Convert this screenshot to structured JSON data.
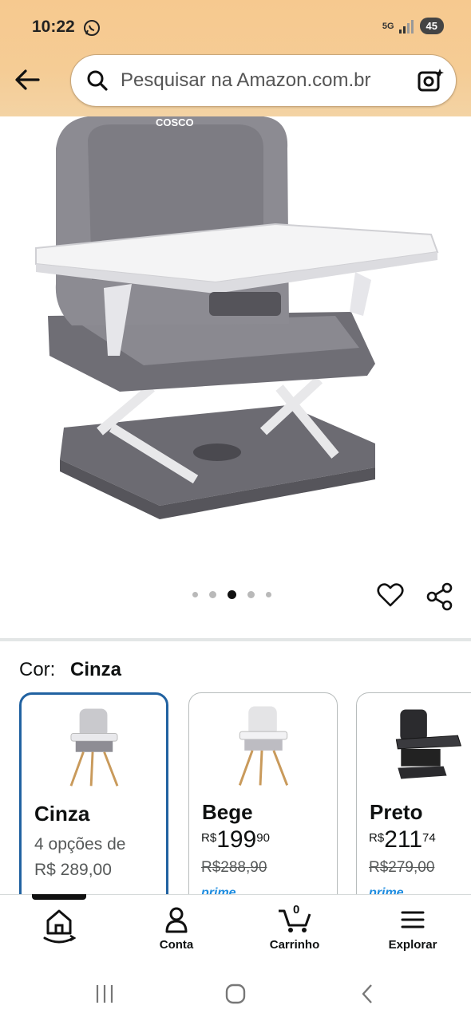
{
  "status_bar": {
    "time": "10:22",
    "network": "5G",
    "battery": "45"
  },
  "search": {
    "placeholder": "Pesquisar na Amazon.com.br"
  },
  "product": {
    "image_brand": "COSCO",
    "pager": {
      "count": 5,
      "active_index": 2
    }
  },
  "color": {
    "label": "Cor:",
    "selected": "Cinza"
  },
  "options": [
    {
      "name": "Cinza",
      "subtitle_line1": "4 opções de",
      "subtitle_line2": "R$ 289,00",
      "selected": true
    },
    {
      "name": "Bege",
      "currency": "R$",
      "price_whole": "199",
      "price_cents": "90",
      "was_price": "R$288,90",
      "badge": "prime"
    },
    {
      "name": "Preto",
      "currency": "R$",
      "price_whole": "211",
      "price_cents": "74",
      "was_price": "R$279,00",
      "badge": "prime"
    }
  ],
  "bottom_nav": {
    "items": [
      {
        "label": "",
        "icon": "home-icon",
        "active": true
      },
      {
        "label": "Conta",
        "icon": "account-icon"
      },
      {
        "label": "Carrinho",
        "icon": "cart-icon",
        "count": "0"
      },
      {
        "label": "Explorar",
        "icon": "menu-icon"
      }
    ]
  },
  "colors": {
    "header": "#f6c98f",
    "selected_border": "#2162a1",
    "prime": "#1f8de0"
  }
}
